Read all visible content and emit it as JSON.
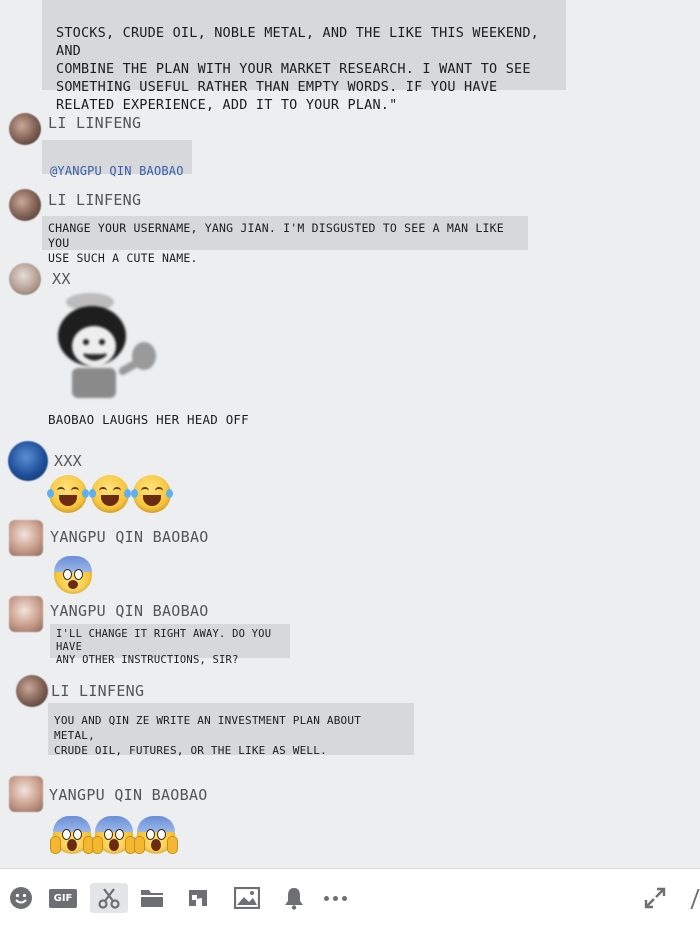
{
  "messages": {
    "top_quote": "STOCKS, CRUDE OIL, NOBLE METAL, AND THE LIKE THIS WEEKEND, AND\nCOMBINE THE PLAN WITH YOUR MARKET RESEARCH. I WANT TO SEE\nSOMETHING USEFUL RATHER THAN EMPTY WORDS. IF YOU HAVE\nRELATED EXPERIENCE, ADD IT TO YOUR PLAN.\"",
    "m1": {
      "sender": "LI LINFENG",
      "text": "@YANGPU QIN BAOBAO"
    },
    "m2": {
      "sender": "LI LINFENG",
      "text": "CHANGE YOUR USERNAME, YANG JIAN. I'M DISGUSTED TO SEE A MAN LIKE YOU\nUSE SUCH A CUTE NAME."
    },
    "m3": {
      "sender": "XX",
      "caption": "BAOBAO LAUGHS HER HEAD OFF"
    },
    "m4": {
      "sender": "XXX"
    },
    "m5": {
      "sender": "YANGPU QIN BAOBAO"
    },
    "m6": {
      "sender": "YANGPU QIN BAOBAO",
      "text": "I'LL CHANGE IT RIGHT AWAY. DO YOU HAVE\nANY OTHER INSTRUCTIONS, SIR?"
    },
    "m7": {
      "sender": "LI LINFENG",
      "text": "YOU AND QIN ZE WRITE AN INVESTMENT PLAN ABOUT METAL,\nCRUDE OIL, FUTURES, OR THE LIKE AS WELL."
    },
    "m8": {
      "sender": "YANGPU QIN BAOBAO"
    }
  },
  "toolbar": {
    "gif_label": "GIF",
    "icons": [
      "smiley-icon",
      "gif-icon",
      "scissors-icon",
      "folder-icon",
      "music-icon",
      "image-icon",
      "bell-icon",
      "more-icon",
      "expand-icon"
    ]
  }
}
